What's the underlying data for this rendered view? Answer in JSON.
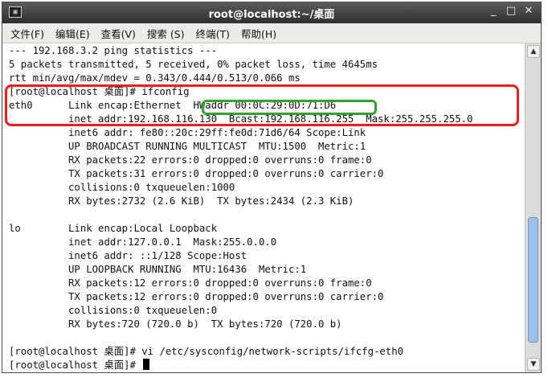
{
  "window": {
    "title": "root@localhost:~/桌面",
    "app_icon_glyph": "▣",
    "buttons": {
      "minimize": "_",
      "maximize": "□",
      "close": "✕"
    }
  },
  "menubar": {
    "items": [
      "文件(F)",
      "编辑(E)",
      "查看(V)",
      "搜索 (S)",
      "终端(T)",
      "帮助(H)"
    ]
  },
  "terminal": {
    "lines": [
      "--- 192.168.3.2 ping statistics ---",
      "5 packets transmitted, 5 received, 0% packet loss, time 4645ms",
      "rtt min/avg/max/mdev = 0.343/0.444/0.513/0.066 ms",
      "[root@localhost 桌面]# ifconfig",
      "eth0      Link encap:Ethernet  HWaddr 00:0C:29:0D:71:D6",
      "          inet addr:192.168.116.130  Bcast:192.168.116.255  Mask:255.255.255.0",
      "          inet6 addr: fe80::20c:29ff:fe0d:71d6/64 Scope:Link",
      "          UP BROADCAST RUNNING MULTICAST  MTU:1500  Metric:1",
      "          RX packets:22 errors:0 dropped:0 overruns:0 frame:0",
      "          TX packets:31 errors:0 dropped:0 overruns:0 carrier:0",
      "          collisions:0 txqueuelen:1000",
      "          RX bytes:2732 (2.6 KiB)  TX bytes:2434 (2.3 KiB)",
      "",
      "lo        Link encap:Local Loopback",
      "          inet addr:127.0.0.1  Mask:255.0.0.0",
      "          inet6 addr: ::1/128 Scope:Host",
      "          UP LOOPBACK RUNNING  MTU:16436  Metric:1",
      "          RX packets:12 errors:0 dropped:0 overruns:0 frame:0",
      "          TX packets:12 errors:0 dropped:0 overruns:0 carrier:0",
      "          collisions:0 txqueuelen:0",
      "          RX bytes:720 (720.0 b)  TX bytes:720 (720.0 b)",
      "",
      "[root@localhost 桌面]# vi /etc/sysconfig/network-scripts/ifcfg-eth0",
      "[root@localhost 桌面]# "
    ]
  },
  "scrollbar": {
    "up_glyph": "▲",
    "down_glyph": "▼",
    "thumb_start_fraction": 0.53,
    "thumb_size_fraction": 0.42
  },
  "annotations": {
    "red_box_color": "#ee1c1c",
    "green_box_color": "#2ea52e"
  }
}
